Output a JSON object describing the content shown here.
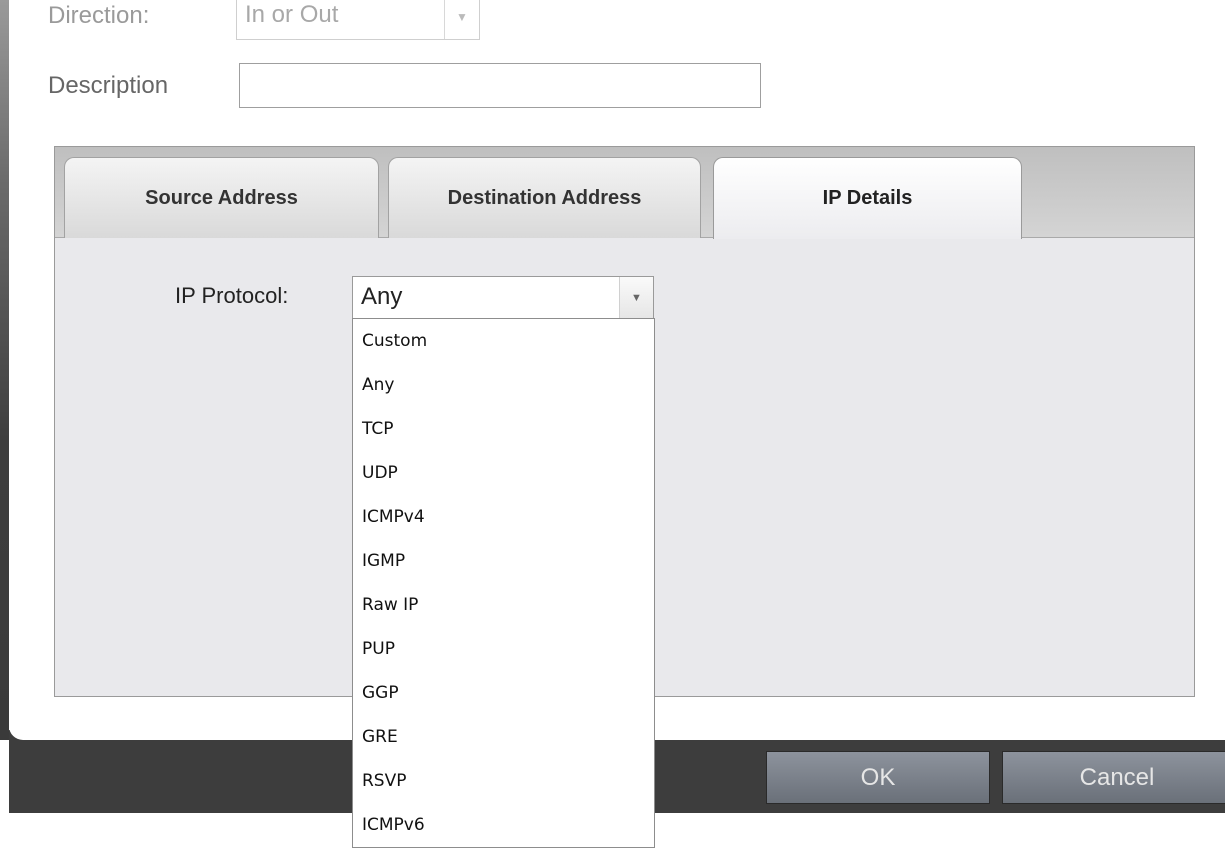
{
  "form": {
    "direction_label": "Direction:",
    "direction_value": "In or Out",
    "description_label": "Description",
    "description_value": ""
  },
  "tabs": [
    {
      "label": "Source Address",
      "active": false
    },
    {
      "label": "Destination Address",
      "active": false
    },
    {
      "label": "IP Details",
      "active": true
    }
  ],
  "ip_details": {
    "protocol_label": "IP Protocol:",
    "protocol_value": "Any",
    "options": [
      "Custom",
      "Any",
      "TCP",
      "UDP",
      "ICMPv4",
      "IGMP",
      "Raw IP",
      "PUP",
      "GGP",
      "GRE",
      "RSVP",
      "ICMPv6"
    ]
  },
  "footer": {
    "ok_label": "OK",
    "cancel_label": "Cancel"
  }
}
